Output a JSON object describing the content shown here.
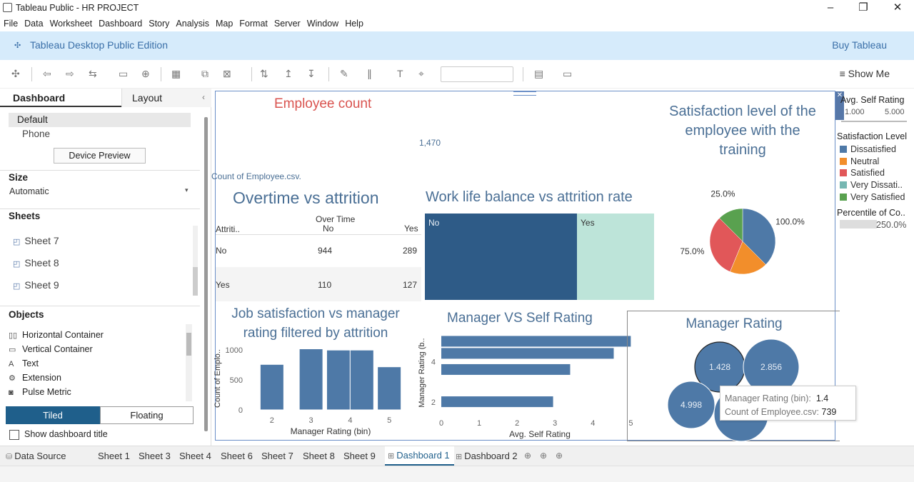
{
  "window": {
    "title": "Tableau Public - HR PROJECT"
  },
  "menu": [
    "File",
    "Data",
    "Worksheet",
    "Dashboard",
    "Story",
    "Analysis",
    "Map",
    "Format",
    "Server",
    "Window",
    "Help"
  ],
  "banner": {
    "edition": "Tableau Desktop Public Edition",
    "buy": "Buy Tableau"
  },
  "toolbar": {
    "show_me": "Show Me"
  },
  "leftpane": {
    "tab_dashboard": "Dashboard",
    "tab_layout": "Layout",
    "device_default": "Default",
    "device_phone": "Phone",
    "device_preview": "Device Preview",
    "size_heading": "Size",
    "size_value": "Automatic",
    "sheets_heading": "Sheets",
    "sheets": [
      "Sheet 7",
      "Sheet 8",
      "Sheet 9"
    ],
    "objects_heading": "Objects",
    "objects": [
      {
        "label": "Horizontal Container",
        "glyph": "▯▯"
      },
      {
        "label": "Vertical Container",
        "glyph": "▭"
      },
      {
        "label": "Text",
        "glyph": "A"
      },
      {
        "label": "Extension",
        "glyph": "⚙"
      },
      {
        "label": "Pulse Metric",
        "glyph": "◙"
      }
    ],
    "tiled": "Tiled",
    "floating": "Floating",
    "show_title": "Show dashboard title"
  },
  "tabs": [
    "Data Source",
    "Sheet 1",
    "Sheet 3",
    "Sheet 4",
    "Sheet 6",
    "Sheet 7",
    "Sheet 8",
    "Sheet 9",
    "Dashboard 1",
    "Dashboard 2"
  ],
  "active_tab": "Dashboard 1",
  "dashboard": {
    "employee_count": {
      "title": "Employee count",
      "value": "1,470",
      "label": "Count of Employee.csv."
    },
    "overtime": {
      "title": "Overtime vs attrition",
      "col_header": "Over Time",
      "row_header": "Attriti..",
      "cols": [
        "No",
        "Yes"
      ],
      "rows": [
        {
          "label": "No",
          "values": [
            "944",
            "289"
          ]
        },
        {
          "label": "Yes",
          "values": [
            "110",
            "127"
          ]
        }
      ]
    },
    "worklife": {
      "title": "Work life balance vs attrition rate",
      "labels": [
        "No",
        "Yes"
      ]
    },
    "satisfaction": {
      "title_lines": [
        "Satisfaction level of the",
        "employee with the",
        "training"
      ],
      "slice_labels": [
        "25.0%",
        "100.0%",
        "75.0%",
        "50.0%"
      ]
    },
    "job_sat": {
      "title_lines": [
        "Job satisfaction vs manager",
        "rating filtered by attrition"
      ],
      "ylabel": "Count of Emplo..",
      "xlabel": "Manager Rating (bin)"
    },
    "mgr_self": {
      "title": "Manager VS Self Rating",
      "ylabel": "Manager Rating (b..",
      "xlabel": "Avg. Self Rating"
    },
    "mgr_rating": {
      "title": "Manager Rating",
      "bubbles": [
        "1.428",
        "2.856",
        "4.998"
      ]
    },
    "tooltip": {
      "line1_key": "Manager Rating (bin):",
      "line1_val": "1.4",
      "line2_key": "Count of Employee.csv:",
      "line2_val": "739"
    }
  },
  "legends": {
    "self_rating_title": "Avg. Self Rating",
    "self_rating_min": "1.000",
    "self_rating_max": "5.000",
    "sat_title": "Satisfaction Level",
    "sat_items": [
      {
        "label": "Dissatisfied",
        "color": "#4e79a7"
      },
      {
        "label": "Neutral",
        "color": "#f28e2b"
      },
      {
        "label": "Satisfied",
        "color": "#e15759"
      },
      {
        "label": "Very Dissati..",
        "color": "#76b7b2"
      },
      {
        "label": "Very Satisfied",
        "color": "#59a14f"
      }
    ],
    "pct_title": "Percentile of Co..",
    "pct_value": "250.0%"
  },
  "chart_data": [
    {
      "type": "pie",
      "title": "Satisfaction level of the employee with the training",
      "categories": [
        "Dissatisfied",
        "Neutral",
        "Satisfied",
        "Very Satisfied"
      ],
      "values": [
        37.5,
        18.75,
        31.25,
        12.5
      ],
      "labels": [
        "100.0%",
        "50.0%",
        "75.0%",
        "25.0%"
      ]
    },
    {
      "type": "bar",
      "title": "Job satisfaction vs manager rating filtered by attrition",
      "ylabel": "Count of Emplo..",
      "xlabel": "Manager Rating (bin)",
      "x": [
        2,
        3,
        3.7,
        4.3,
        5
      ],
      "values": [
        760,
        1020,
        1000,
        1000,
        720
      ],
      "yticks": [
        0,
        500,
        1000
      ],
      "xticks": [
        2,
        3,
        4,
        5
      ],
      "ylim": [
        0,
        1050
      ]
    },
    {
      "type": "bar",
      "orientation": "horizontal",
      "title": "Manager VS Self Rating",
      "ylabel": "Manager Rating (b..",
      "xlabel": "Avg. Self Rating",
      "y": [
        5,
        4.4,
        3.6,
        2
      ],
      "values": [
        5.0,
        4.55,
        3.4,
        2.95
      ],
      "xticks": [
        0,
        1,
        2,
        3,
        4,
        5
      ],
      "yticks": [
        2,
        4
      ],
      "xlim": [
        0,
        5.2
      ]
    }
  ]
}
